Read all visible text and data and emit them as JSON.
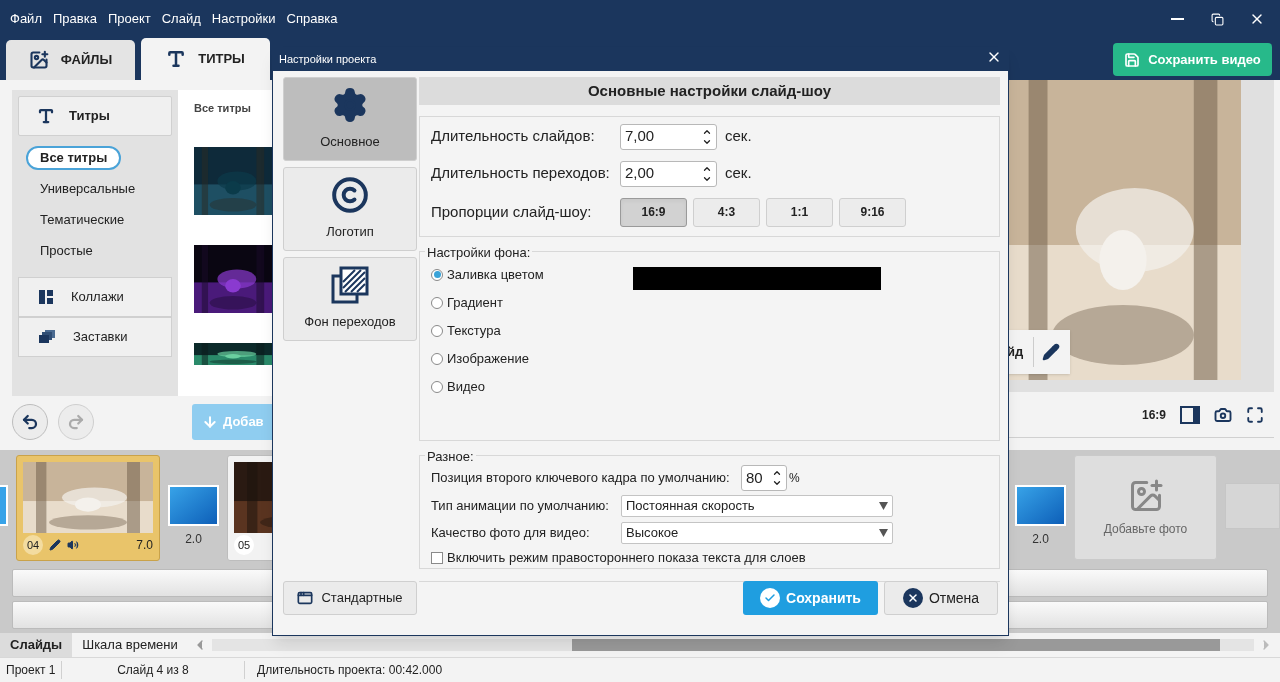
{
  "menu": [
    "Файл",
    "Правка",
    "Проект",
    "Слайд",
    "Настройки",
    "Справка"
  ],
  "tabs": [
    {
      "label": "ФАЙЛЫ",
      "selected": false
    },
    {
      "label": "ТИТРЫ",
      "selected": true
    }
  ],
  "save_video_button": "Сохранить видео",
  "sidebar": {
    "header": "Титры",
    "items": [
      {
        "label": "Все титры",
        "selected": true
      },
      {
        "label": "Универсальные",
        "selected": false
      },
      {
        "label": "Тематические",
        "selected": false
      },
      {
        "label": "Простые",
        "selected": false
      }
    ],
    "buttons": [
      {
        "label": "Коллажи"
      },
      {
        "label": "Заставки"
      }
    ]
  },
  "gallery": {
    "heading": "Все титры"
  },
  "add_button": "Добав",
  "preview": {
    "slide_button": "йд",
    "aspect": "16:9"
  },
  "timeline": {
    "left": [
      {
        "kind": "slide",
        "number": "04",
        "duration": "7.0",
        "selected": true
      },
      {
        "kind": "transition",
        "duration": "2.0"
      },
      {
        "kind": "slide",
        "number": "05",
        "selected": false
      }
    ],
    "right": [
      {
        "kind": "transition",
        "duration": "2.0"
      },
      {
        "kind": "add",
        "label": "Добавьте фото"
      }
    ]
  },
  "bottom_tabs": [
    {
      "label": "Слайды",
      "selected": true
    },
    {
      "label": "Шкала времени",
      "selected": false
    }
  ],
  "status_bar": [
    "Проект 1",
    "Слайд 4 из 8",
    "Длительность проекта: 00:42.000"
  ],
  "dialog": {
    "title": "Настройки проекта",
    "nav": [
      {
        "label": "Основное",
        "selected": true
      },
      {
        "label": "Логотип",
        "selected": false
      },
      {
        "label": "Фон переходов",
        "selected": false
      }
    ],
    "heading": "Основные настройки слайд-шоу",
    "durations": [
      {
        "label": "Длительность слайдов:",
        "value": "7,00",
        "unit": "сек."
      },
      {
        "label": "Длительность переходов:",
        "value": "2,00",
        "unit": "сек."
      }
    ],
    "aspect": {
      "label": "Пропорции слайд-шоу:",
      "options": [
        {
          "label": "16:9",
          "selected": true
        },
        {
          "label": "4:3",
          "selected": false
        },
        {
          "label": "1:1",
          "selected": false
        },
        {
          "label": "9:16",
          "selected": false
        }
      ]
    },
    "background": {
      "title": "Настройки фона:",
      "color": "#000000",
      "options": [
        {
          "label": "Заливка цветом",
          "selected": true
        },
        {
          "label": "Градиент",
          "selected": false
        },
        {
          "label": "Текстура",
          "selected": false
        },
        {
          "label": "Изображение",
          "selected": false
        },
        {
          "label": "Видео",
          "selected": false
        }
      ]
    },
    "misc": {
      "title": "Разное:",
      "keyframe": {
        "label": "Позиция второго ключевого кадра по умолчанию:",
        "value": "80",
        "unit": "%"
      },
      "selects": [
        {
          "label": "Тип анимации по умолчанию:",
          "value": "Постоянная скорость"
        },
        {
          "label": "Качество фото для видео:",
          "value": "Высокое"
        }
      ],
      "rtl": {
        "label": "Включить режим правостороннего показа текста для слоев",
        "checked": false
      }
    },
    "buttons": {
      "defaults": "Стандартные",
      "save": "Сохранить",
      "cancel": "Отмена"
    }
  }
}
